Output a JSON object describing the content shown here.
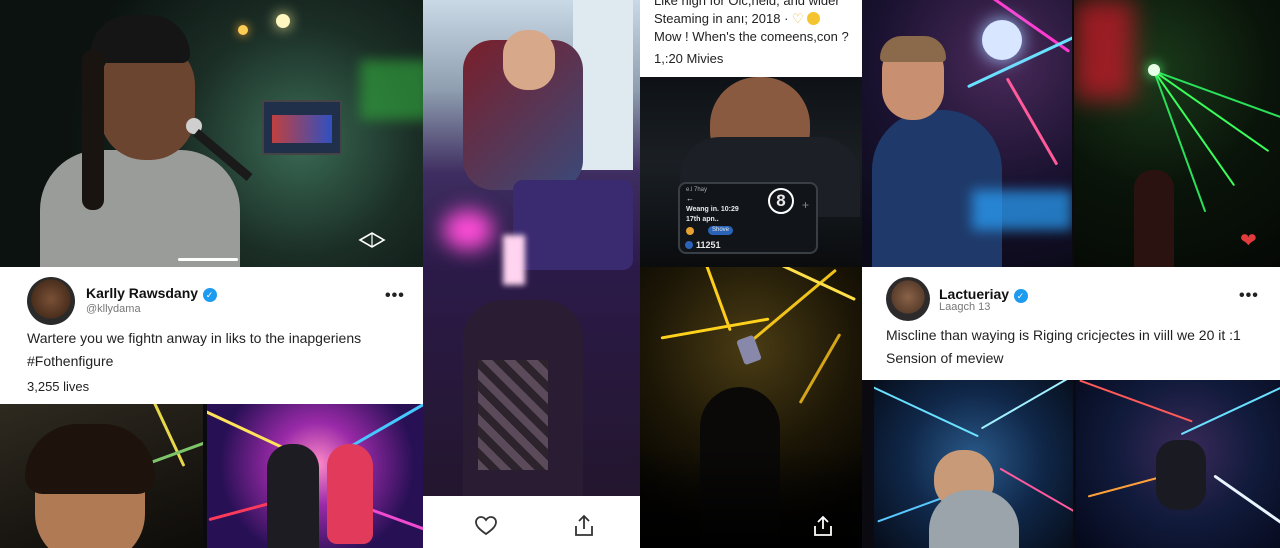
{
  "post1": {
    "author_name": "Karlly Rawsdany",
    "handle": "@kllydama",
    "text_line1": "Wartere you we fightn anway in liks to the inapgeriens",
    "text_line2": "#Fothenfigure",
    "count": "3,255 lives"
  },
  "post2": {
    "text_line1": "Like high for Olc,held, and wider",
    "text_line2": "Steaming in anı; 2018 ·",
    "text_line3": "Mow ! When's the comeens,con ?",
    "count": "1,:20 Mivies",
    "phone_line1": "Weang in. 10:29",
    "phone_line2": "17th apn..",
    "phone_badge": "Shove",
    "phone_count": "11251",
    "phone_number": "8",
    "phone_top": "e.l 7hay"
  },
  "post3": {
    "author_name": "Lactueriay",
    "handle": "Laagch 13",
    "text_line1": "Miscline than waying is Riging cricjectes in viill we 20 it :1",
    "text_line2": "Sension of meview"
  },
  "icons": {
    "more": "•••",
    "verified": "✓",
    "heart": "heart-outline-icon",
    "share": "share-icon"
  },
  "colors": {
    "verified": "#1d9bf0",
    "heart_red": "#e23b3b"
  }
}
